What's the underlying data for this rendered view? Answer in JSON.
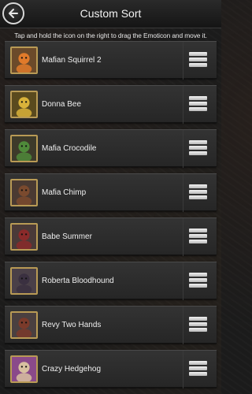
{
  "header": {
    "title": "Custom Sort",
    "back_icon": "arrow-left-icon"
  },
  "instructions": "Tap and hold the icon on the right to drag the Emoticon and move it.",
  "items": [
    {
      "name": "Mafian Squirrel 2",
      "icon": "squirrel",
      "bg": "#6b4a2a",
      "fg": "#e07a2a"
    },
    {
      "name": "Donna Bee",
      "icon": "bee",
      "bg": "#5a4a1e",
      "fg": "#d9b23a"
    },
    {
      "name": "Mafia Crocodile",
      "icon": "crocodile",
      "bg": "#3d3a2a",
      "fg": "#4f8a3a"
    },
    {
      "name": "Mafia Chimp",
      "icon": "chimp",
      "bg": "#4a3a32",
      "fg": "#7a4a2e"
    },
    {
      "name": "Babe Summer",
      "icon": "summer",
      "bg": "#4a3a38",
      "fg": "#8a2a2a"
    },
    {
      "name": "Roberta Bloodhound",
      "icon": "bloodhound",
      "bg": "#4a4048",
      "fg": "#3a3040"
    },
    {
      "name": "Revy Two Hands",
      "icon": "revy",
      "bg": "#4a4040",
      "fg": "#7a3a2a"
    },
    {
      "name": "Crazy Hedgehog",
      "icon": "hedgehog",
      "bg": "#8a4a8a",
      "fg": "#d8c0a0"
    }
  ]
}
